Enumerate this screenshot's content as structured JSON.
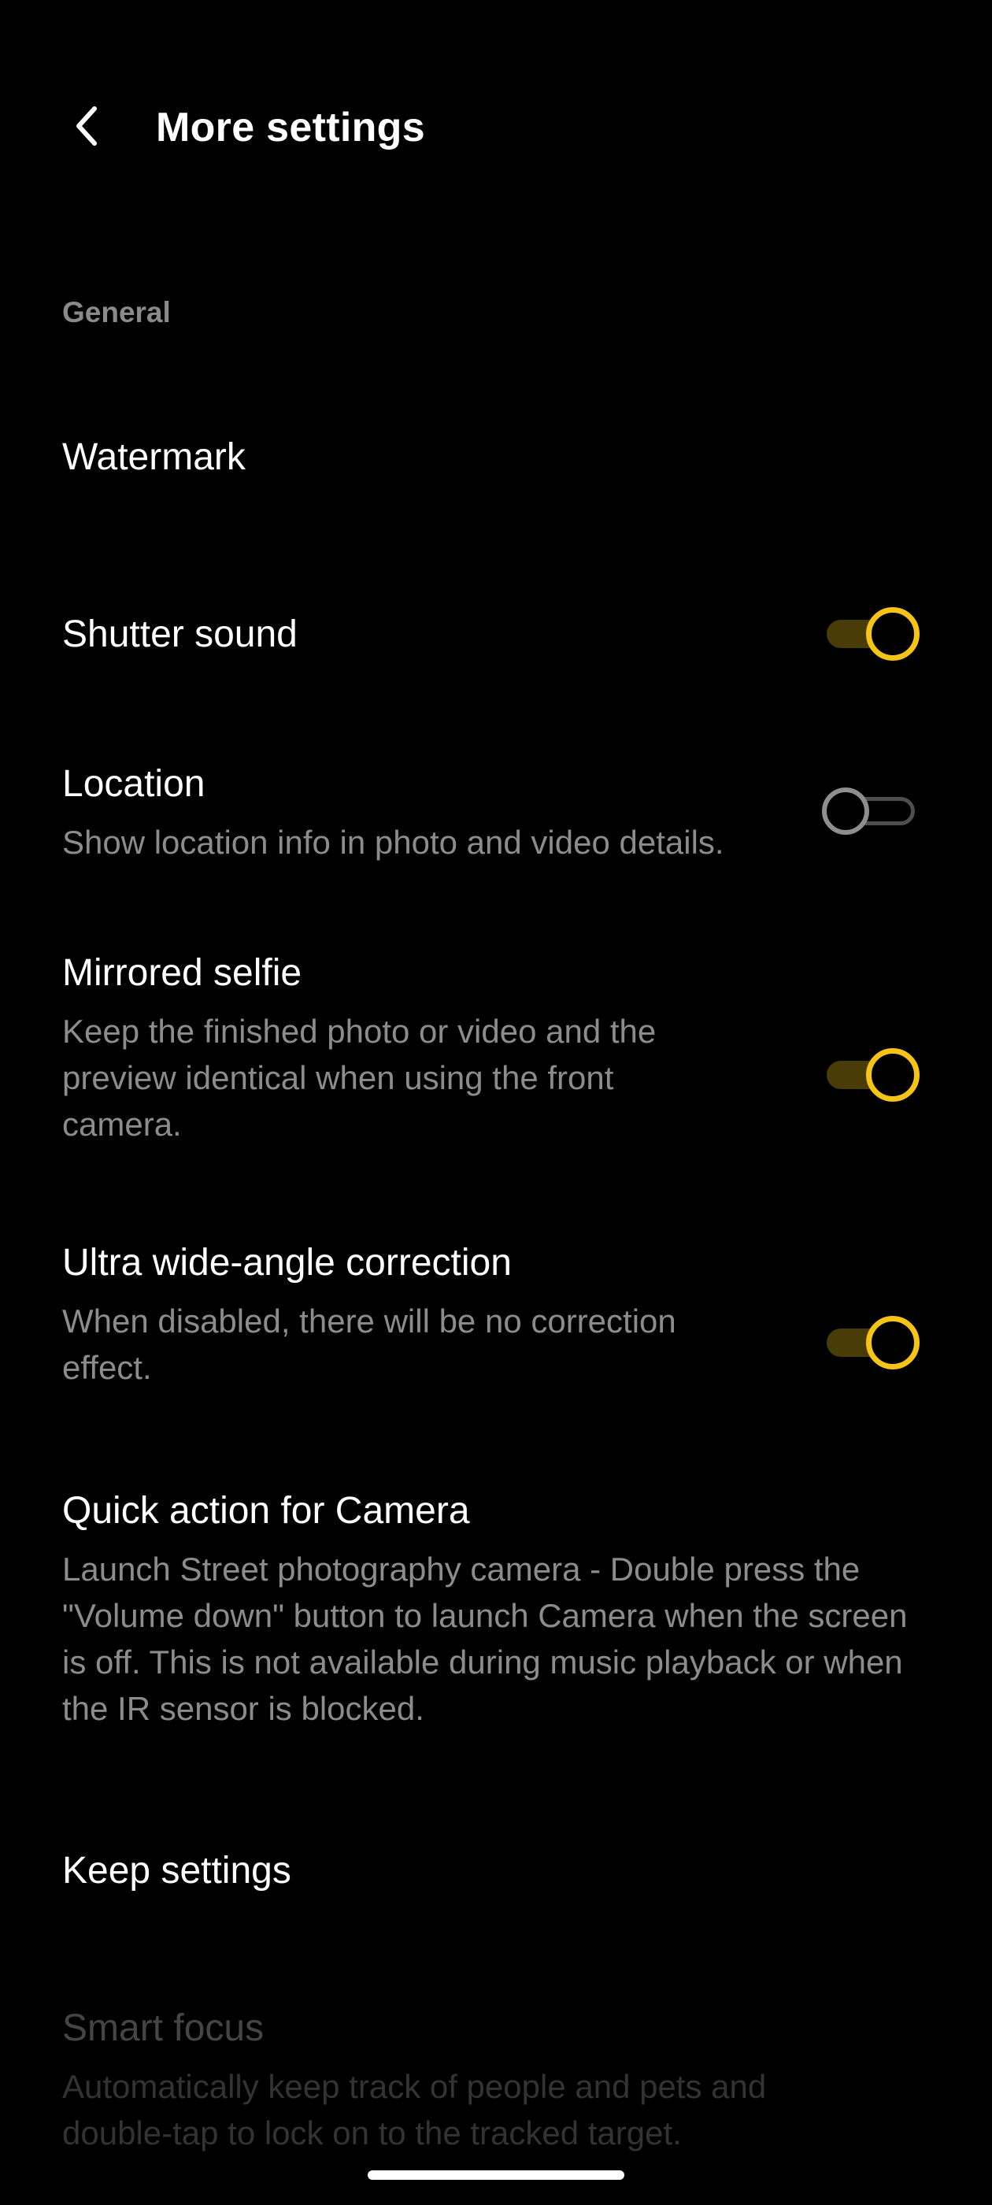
{
  "header": {
    "title": "More settings",
    "back_icon": "chevron-left-icon"
  },
  "section_general": {
    "label": "General"
  },
  "settings": {
    "watermark": {
      "title": "Watermark"
    },
    "shutter_sound": {
      "title": "Shutter sound",
      "enabled": true
    },
    "location": {
      "title": "Location",
      "subtitle": "Show location info in photo and video details.",
      "enabled": false
    },
    "mirrored_selfie": {
      "title": "Mirrored selfie",
      "subtitle": "Keep the finished photo or video and the preview identical when using the front camera.",
      "enabled": true
    },
    "ultra_wide_correction": {
      "title": "Ultra wide-angle correction",
      "subtitle": "When disabled, there will be no correction effect.",
      "enabled": true
    },
    "quick_action": {
      "title": "Quick action for Camera",
      "subtitle": "Launch Street photography camera - Double press the \"Volume down\" button to launch Camera when the screen is off. This is not available during music playback or when the IR sensor is blocked."
    },
    "keep_settings": {
      "title": "Keep settings"
    },
    "smart_focus": {
      "title": "Smart focus",
      "subtitle": "Automatically keep track of people and pets and double-tap to lock on to the tracked target.",
      "disabled": true
    }
  },
  "colors": {
    "background": "#000000",
    "accent": "#f6c416",
    "accent_track": "#4a3c06",
    "secondary_text": "#8c8c8c",
    "section_text": "#8a8a8a"
  }
}
